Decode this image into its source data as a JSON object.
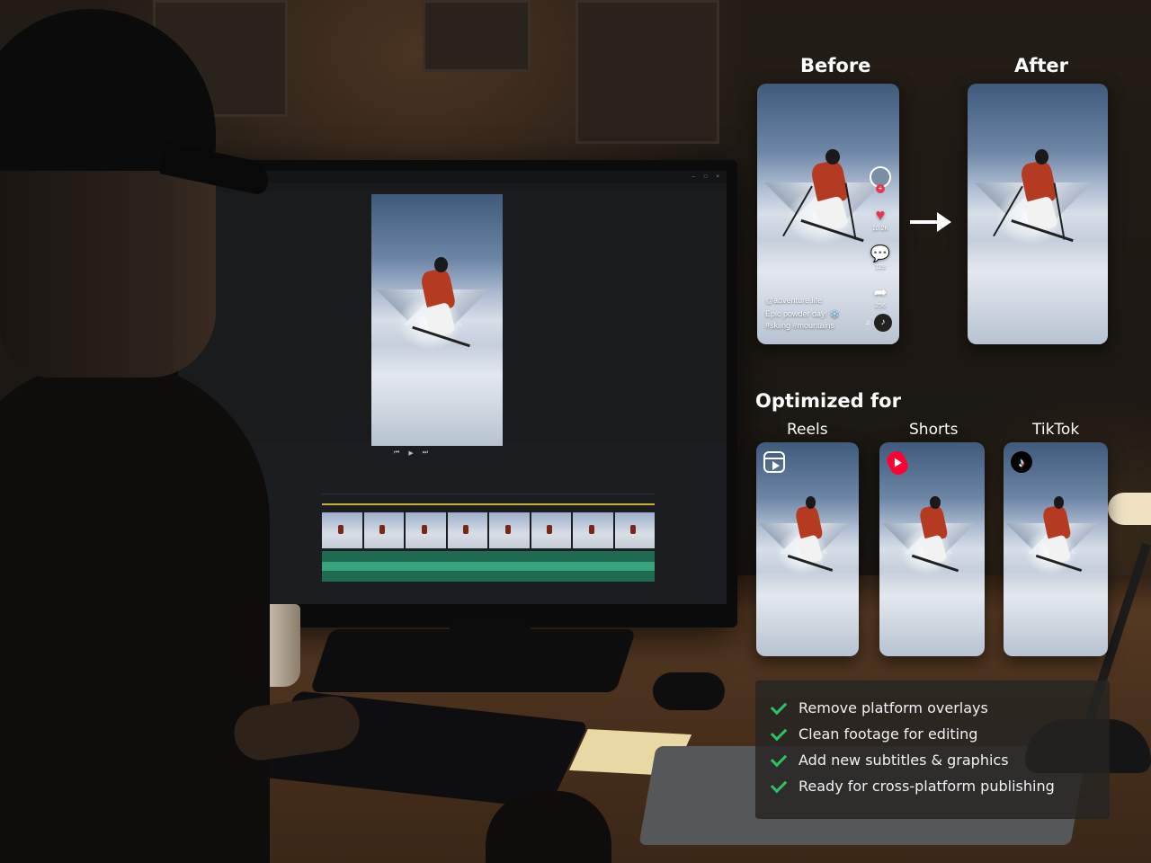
{
  "before": {
    "title": "Before",
    "handle": "@adventure.life",
    "caption_line1": "Epic powder day! ❄️",
    "caption_line2": "#skiing #mountains",
    "likes": "10.2K",
    "comments": "128",
    "shares": "256"
  },
  "after": {
    "title": "After"
  },
  "optimized": {
    "heading": "Optimized for",
    "platforms": [
      {
        "name": "Reels",
        "icon": "reels-icon"
      },
      {
        "name": "Shorts",
        "icon": "youtube-shorts-icon"
      },
      {
        "name": "TikTok",
        "icon": "tiktok-icon"
      }
    ]
  },
  "benefits": [
    "Remove platform overlays",
    "Clean footage for editing",
    "Add new subtitles & graphics",
    "Ready for cross-platform publishing"
  ],
  "colors": {
    "check_green": "#2fc163",
    "like_red": "#e8344a",
    "shorts_red": "#ff0033"
  }
}
